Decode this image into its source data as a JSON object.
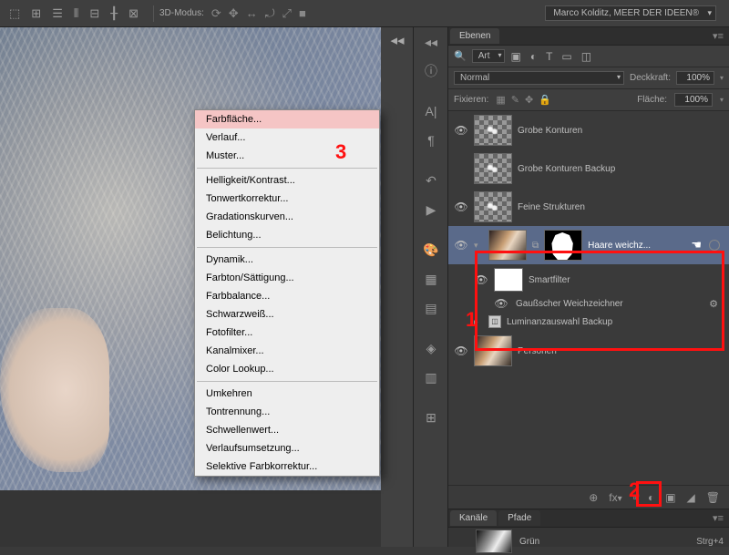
{
  "topbar": {
    "label3d": "3D-Modus:",
    "workspace": "Marco Kolditz, MEER DER IDEEN®"
  },
  "context_menu": {
    "items": [
      {
        "label": "Farbfläche...",
        "hl": true
      },
      {
        "label": "Verlauf..."
      },
      {
        "label": "Muster..."
      },
      {
        "sep": true
      },
      {
        "label": "Helligkeit/Kontrast..."
      },
      {
        "label": "Tonwertkorrektur..."
      },
      {
        "label": "Gradationskurven..."
      },
      {
        "label": "Belichtung..."
      },
      {
        "sep": true
      },
      {
        "label": "Dynamik..."
      },
      {
        "label": "Farbton/Sättigung..."
      },
      {
        "label": "Farbbalance..."
      },
      {
        "label": "Schwarzweiß..."
      },
      {
        "label": "Fotofilter..."
      },
      {
        "label": "Kanalmixer..."
      },
      {
        "label": "Color Lookup..."
      },
      {
        "sep": true
      },
      {
        "label": "Umkehren"
      },
      {
        "label": "Tontrennung..."
      },
      {
        "label": "Schwellenwert..."
      },
      {
        "label": "Verlaufsumsetzung..."
      },
      {
        "label": "Selektive Farbkorrektur..."
      }
    ]
  },
  "annot": {
    "a1": "1",
    "a2": "2",
    "a3": "3"
  },
  "layers_panel": {
    "tab": "Ebenen",
    "filter_kind": "Art",
    "blend_mode": "Normal",
    "opacity_label": "Deckkraft:",
    "opacity_value": "100%",
    "lock_label": "Fixieren:",
    "fill_label": "Fläche:",
    "fill_value": "100%",
    "search_icon": "🔍",
    "layers": [
      {
        "name": "Grobe Konturen"
      },
      {
        "name": "Grobe Konturen Backup"
      },
      {
        "name": "Feine Strukturen"
      },
      {
        "name": "Haare weichz...",
        "selected": true
      },
      {
        "name": "Smartfilter",
        "is_smart": true
      },
      {
        "filter": "Gaußscher Weichzeichner"
      },
      {
        "name": "Luminanzauswahl Backup"
      },
      {
        "name": "Personen"
      }
    ],
    "footer_icons": [
      "⊕",
      "fx",
      "▫",
      "◐",
      "▣",
      "◢",
      "🗑"
    ]
  },
  "channels_panel": {
    "tabs": [
      "Kanäle",
      "Pfade"
    ],
    "row": {
      "name": "Grün",
      "shortcut": "Strg+4"
    }
  }
}
